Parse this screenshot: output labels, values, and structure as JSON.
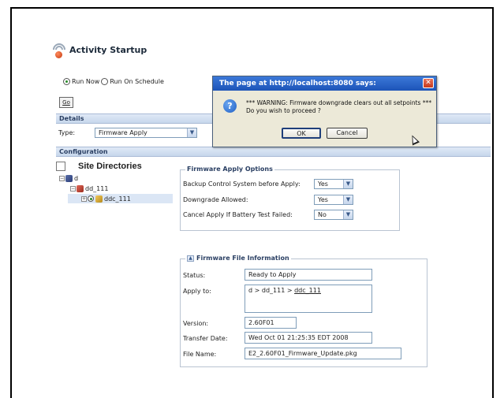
{
  "app": {
    "title": "Activity Startup"
  },
  "run_options": {
    "now_label": "Run Now",
    "schedule_label": "Run On Schedule",
    "selected": "now"
  },
  "go_button": "Go",
  "sections": {
    "details": "Details",
    "configuration": "Configuration"
  },
  "details": {
    "type_label": "Type:",
    "type_value": "Firmware Apply"
  },
  "tree": {
    "title": "Site Directories",
    "nodes": {
      "root": "d",
      "child": "dd_111",
      "leaf": "ddc_111"
    }
  },
  "options": {
    "legend": "Firmware Apply Options",
    "rows": [
      {
        "label": "Backup Control System before Apply:",
        "value": "Yes"
      },
      {
        "label": "Downgrade Allowed:",
        "value": "Yes"
      },
      {
        "label": "Cancel Apply If Battery Test Failed:",
        "value": "No"
      }
    ]
  },
  "file_info": {
    "legend": "Firmware File Information",
    "status_label": "Status:",
    "status_value": "Ready to Apply",
    "apply_label": "Apply to:",
    "apply_prefix": "d > dd_111 > ",
    "apply_link": "ddc_111",
    "version_label": "Version:",
    "version_value": "2.60F01",
    "transfer_label": "Transfer Date:",
    "transfer_value": "Wed Oct 01 21:25:35 EDT 2008",
    "file_label": "File Name:",
    "file_value": "E2_2.60F01_Firmware_Update.pkg"
  },
  "dialog": {
    "title": "The page at http://localhost:8080 says:",
    "line1": "*** WARNING: Firmware downgrade clears out all setpoints ***",
    "line2": "Do you wish to proceed ?",
    "ok": "OK",
    "cancel": "Cancel"
  },
  "colors": {
    "section_bar": "#c7d7ec",
    "dialog_title": "#1d54b8",
    "close": "#c5391c"
  }
}
